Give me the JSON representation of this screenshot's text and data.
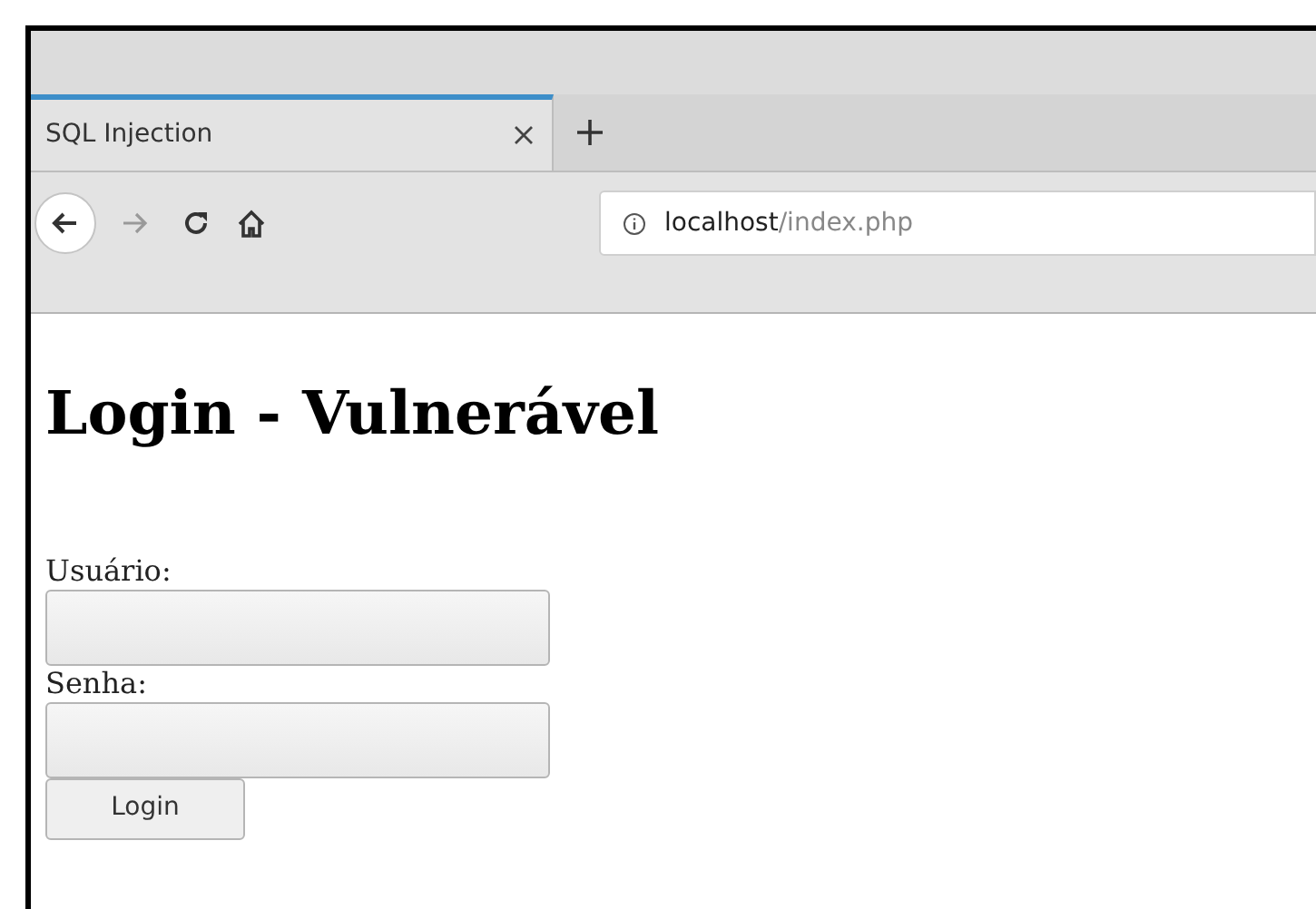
{
  "tabs": [
    {
      "title": "SQL Injection",
      "selected": true
    }
  ],
  "address": {
    "host": "localhost",
    "path": "/index.php"
  },
  "page": {
    "heading": "Login - Vulnerável",
    "fields": [
      {
        "label": "Usuário:"
      },
      {
        "label": "Senha:"
      }
    ],
    "button": "Login"
  }
}
